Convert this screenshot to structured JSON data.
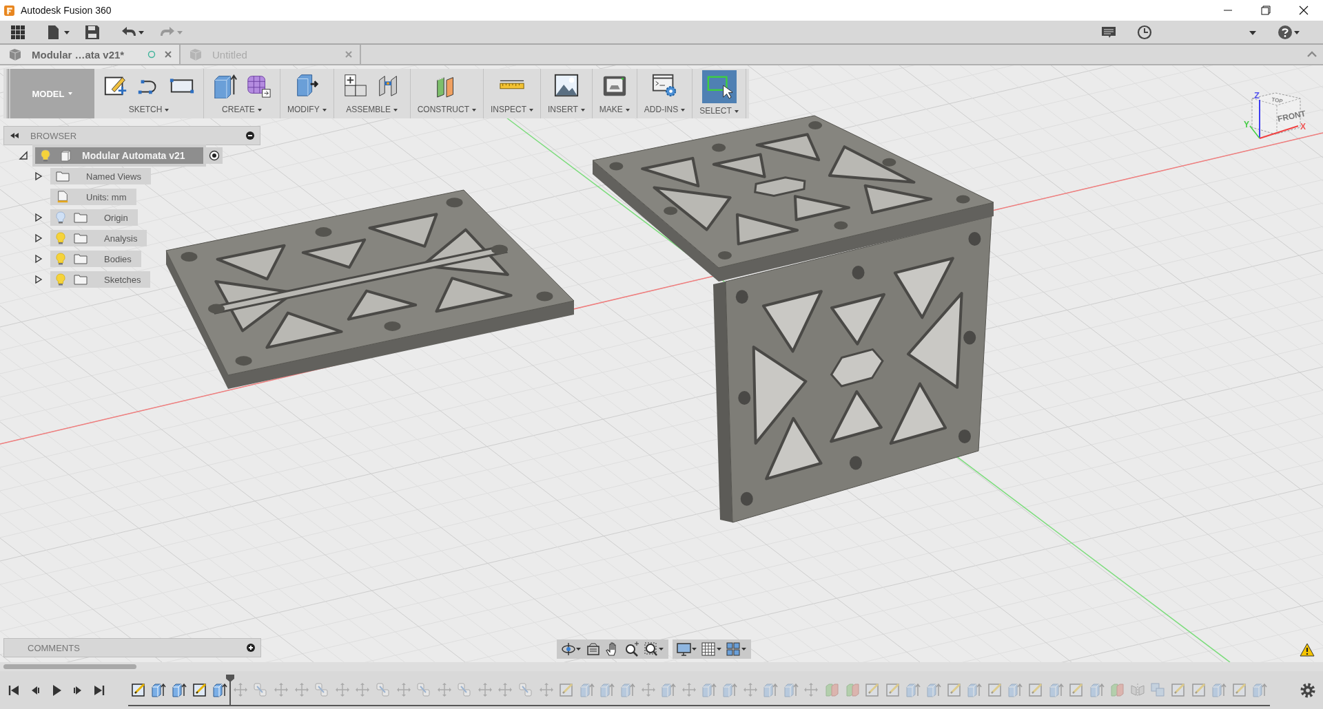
{
  "window": {
    "title": "Autodesk Fusion 360"
  },
  "document_tabs": [
    {
      "label": "Modular …ata v21*",
      "selected": true
    },
    {
      "label": "Untitled",
      "selected": false
    }
  ],
  "toolbar": {
    "workspace": "MODEL",
    "groups": [
      {
        "label": "SKETCH",
        "selected": false,
        "tools": [
          {
            "kind": "create-sketch"
          },
          {
            "kind": "arc"
          },
          {
            "kind": "rectangle"
          }
        ]
      },
      {
        "label": "CREATE",
        "selected": false,
        "tools": [
          {
            "kind": "extrude"
          },
          {
            "kind": "form"
          }
        ]
      },
      {
        "label": "MODIFY",
        "selected": false,
        "tools": [
          {
            "kind": "press-pull"
          }
        ]
      },
      {
        "label": "ASSEMBLE",
        "selected": false,
        "tools": [
          {
            "kind": "new-component"
          },
          {
            "kind": "joint"
          }
        ]
      },
      {
        "label": "CONSTRUCT",
        "selected": false,
        "tools": [
          {
            "kind": "offset-plane"
          }
        ]
      },
      {
        "label": "INSPECT",
        "selected": false,
        "tools": [
          {
            "kind": "measure"
          }
        ]
      },
      {
        "label": "INSERT",
        "selected": false,
        "tools": [
          {
            "kind": "canvas"
          }
        ]
      },
      {
        "label": "MAKE",
        "selected": false,
        "tools": [
          {
            "kind": "print"
          }
        ]
      },
      {
        "label": "ADD-INS",
        "selected": false,
        "tools": [
          {
            "kind": "scripts"
          }
        ]
      },
      {
        "label": "SELECT",
        "selected": true,
        "tools": [
          {
            "kind": "select"
          }
        ]
      }
    ]
  },
  "browser": {
    "title": "BROWSER",
    "root": {
      "label": "Modular Automata v21",
      "visible": true,
      "expanded": true,
      "active": true,
      "selected": true,
      "children": [
        {
          "label": "Named Views",
          "kind": "folder",
          "expanded": false,
          "selected": false
        },
        {
          "label": "Units: mm",
          "kind": "units",
          "selected": false
        },
        {
          "label": "Origin",
          "kind": "folder",
          "visible": false,
          "expanded": false,
          "selected": false
        },
        {
          "label": "Analysis",
          "kind": "folder",
          "visible": true,
          "expanded": false,
          "selected": false
        },
        {
          "label": "Bodies",
          "kind": "folder",
          "visible": true,
          "expanded": false,
          "selected": false
        },
        {
          "label": "Sketches",
          "kind": "folder",
          "visible": true,
          "expanded": false,
          "selected": false
        }
      ]
    }
  },
  "view_cube": {
    "faces": [
      "TOP",
      "FRONT"
    ],
    "axes": [
      "Z",
      "Y",
      "X"
    ]
  },
  "comments": {
    "title": "COMMENTS"
  },
  "timeline": {
    "features": [
      {
        "kind": "sketch",
        "rolled_back": false
      },
      {
        "kind": "extrude",
        "rolled_back": false
      },
      {
        "kind": "extrude",
        "rolled_back": false
      },
      {
        "kind": "sketch",
        "rolled_back": false
      },
      {
        "kind": "extrude",
        "rolled_back": false
      },
      {
        "kind": "move",
        "rolled_back": true
      },
      {
        "kind": "joint",
        "rolled_back": true
      },
      {
        "kind": "move",
        "rolled_back": true
      },
      {
        "kind": "move",
        "rolled_back": true
      },
      {
        "kind": "joint",
        "rolled_back": true
      },
      {
        "kind": "move",
        "rolled_back": true
      },
      {
        "kind": "move",
        "rolled_back": true
      },
      {
        "kind": "joint",
        "rolled_back": true
      },
      {
        "kind": "move",
        "rolled_back": true
      },
      {
        "kind": "joint",
        "rolled_back": true
      },
      {
        "kind": "move",
        "rolled_back": true
      },
      {
        "kind": "joint",
        "rolled_back": true
      },
      {
        "kind": "move",
        "rolled_back": true
      },
      {
        "kind": "move",
        "rolled_back": true
      },
      {
        "kind": "joint",
        "rolled_back": true
      },
      {
        "kind": "move",
        "rolled_back": true
      },
      {
        "kind": "sketch",
        "rolled_back": true
      },
      {
        "kind": "extrude",
        "rolled_back": true
      },
      {
        "kind": "extrude",
        "rolled_back": true
      },
      {
        "kind": "extrude",
        "rolled_back": true
      },
      {
        "kind": "move",
        "rolled_back": true
      },
      {
        "kind": "extrude",
        "rolled_back": true
      },
      {
        "kind": "move",
        "rolled_back": true
      },
      {
        "kind": "extrude",
        "rolled_back": true
      },
      {
        "kind": "extrude",
        "rolled_back": true
      },
      {
        "kind": "move",
        "rolled_back": true
      },
      {
        "kind": "extrude",
        "rolled_back": true
      },
      {
        "kind": "extrude",
        "rolled_back": true
      },
      {
        "kind": "move",
        "rolled_back": true
      },
      {
        "kind": "combine",
        "rolled_back": true
      },
      {
        "kind": "combine",
        "rolled_back": true
      },
      {
        "kind": "sketch",
        "rolled_back": true
      },
      {
        "kind": "sketch",
        "rolled_back": true
      },
      {
        "kind": "extrude",
        "rolled_back": true
      },
      {
        "kind": "extrude",
        "rolled_back": true
      },
      {
        "kind": "sketch",
        "rolled_back": true
      },
      {
        "kind": "extrude",
        "rolled_back": true
      },
      {
        "kind": "sketch",
        "rolled_back": true
      },
      {
        "kind": "extrude",
        "rolled_back": true
      },
      {
        "kind": "sketch",
        "rolled_back": true
      },
      {
        "kind": "extrude",
        "rolled_back": true
      },
      {
        "kind": "sketch",
        "rolled_back": true
      },
      {
        "kind": "extrude",
        "rolled_back": true
      },
      {
        "kind": "combine",
        "rolled_back": true
      },
      {
        "kind": "mirror",
        "rolled_back": true
      },
      {
        "kind": "pattern",
        "rolled_back": true
      },
      {
        "kind": "sketch",
        "rolled_back": true
      },
      {
        "kind": "sketch",
        "rolled_back": true
      },
      {
        "kind": "extrude",
        "rolled_back": true
      },
      {
        "kind": "sketch",
        "rolled_back": true
      },
      {
        "kind": "extrude",
        "rolled_back": true
      }
    ]
  }
}
